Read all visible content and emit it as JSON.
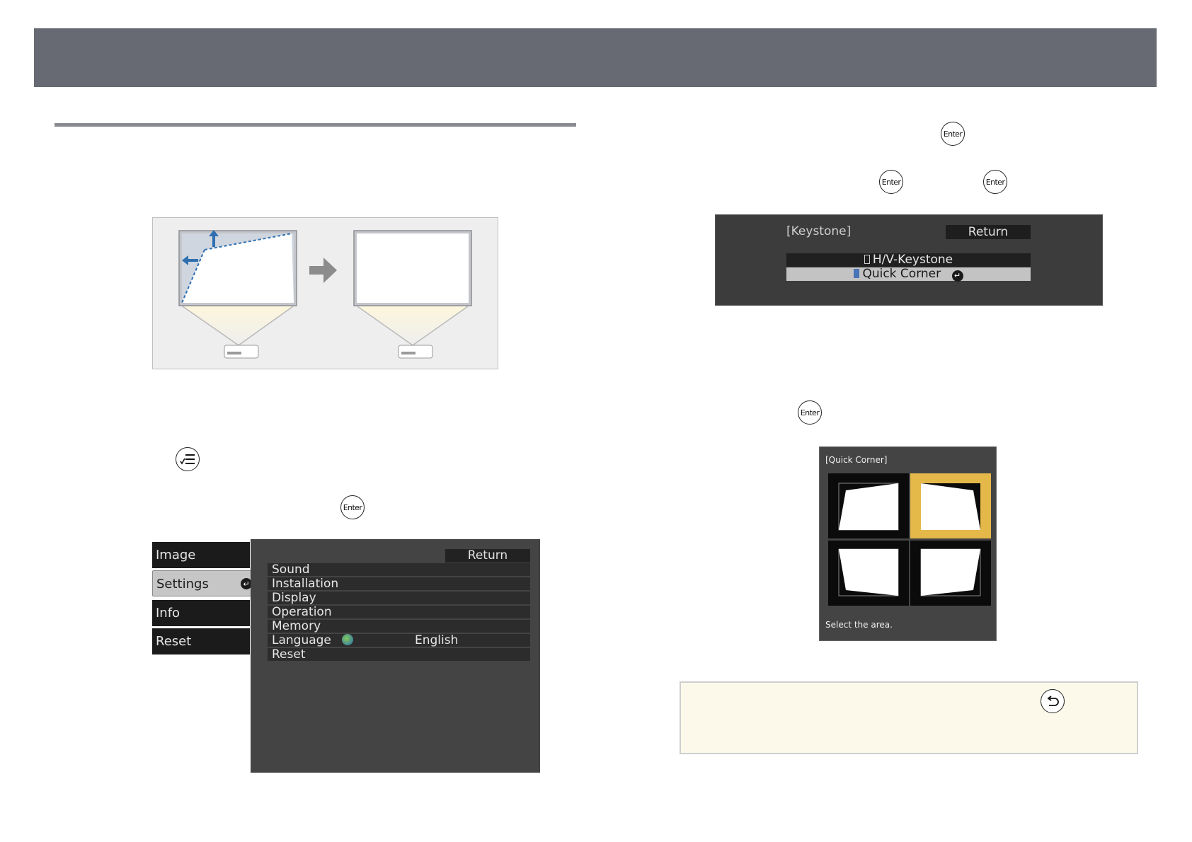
{
  "header": {
    "title": ""
  },
  "icons": {
    "enter_label": "Enter",
    "menu_button": "menu-icon",
    "back_button": "back-icon"
  },
  "settings_menu": {
    "tabs": [
      {
        "label": "Image"
      },
      {
        "label": "Settings"
      },
      {
        "label": "Info"
      },
      {
        "label": "Reset"
      }
    ],
    "return_label": "Return",
    "items": [
      {
        "label": "Sound",
        "value": ""
      },
      {
        "label": "Installation",
        "value": ""
      },
      {
        "label": "Display",
        "value": ""
      },
      {
        "label": "Operation",
        "value": ""
      },
      {
        "label": "Memory",
        "value": ""
      },
      {
        "label": "Language",
        "value": "English"
      },
      {
        "label": "Reset",
        "value": ""
      }
    ]
  },
  "keystone_menu": {
    "title": "[Keystone]",
    "return_label": "Return",
    "options": [
      {
        "label": "H/V-Keystone",
        "selected": false
      },
      {
        "label": "Quick Corner",
        "selected": true
      }
    ]
  },
  "quick_corner": {
    "title": "[Quick Corner]",
    "footer": "Select the area.",
    "selected_cell": 1
  }
}
